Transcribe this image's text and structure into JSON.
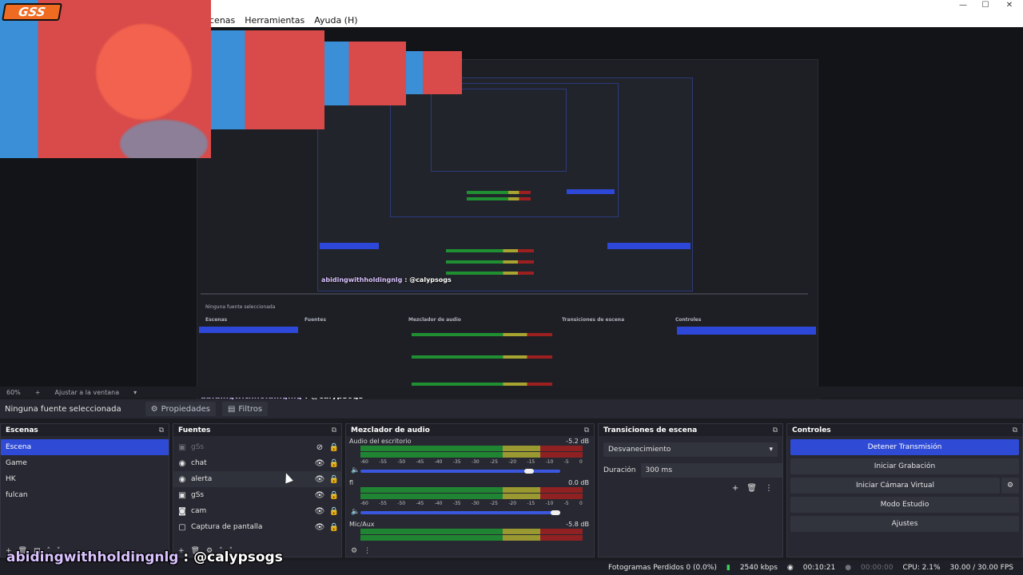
{
  "menubar": {
    "items": [
      "cenas",
      "Herramientas",
      "Ayuda (H)"
    ]
  },
  "window": {
    "minimize": "—",
    "maximize": "☐",
    "close": "✕"
  },
  "logo": "GSS",
  "zoom": {
    "level": "60%",
    "fit": "Ajustar a la ventana"
  },
  "selection": {
    "label": "Ninguna fuente seleccionada",
    "properties": "Propiedades",
    "filters": "Filtros"
  },
  "scenes": {
    "title": "Escenas",
    "items": [
      "Escena",
      "Game",
      "HK",
      "fulcan"
    ],
    "selected_index": 0
  },
  "sources": {
    "title": "Fuentes",
    "items": [
      {
        "label": "gSs",
        "icon": "image",
        "visible": false
      },
      {
        "label": "chat",
        "icon": "browser",
        "visible": true
      },
      {
        "label": "alerta",
        "icon": "browser",
        "visible": true
      },
      {
        "label": "gSs",
        "icon": "image",
        "visible": true
      },
      {
        "label": "cam",
        "icon": "camera",
        "visible": true
      },
      {
        "label": "Captura de pantalla",
        "icon": "display",
        "visible": true
      }
    ]
  },
  "mixer": {
    "title": "Mezclador de audio",
    "ticks": [
      "-60",
      "-55",
      "-50",
      "-45",
      "-40",
      "-35",
      "-30",
      "-25",
      "-20",
      "-15",
      "-10",
      "-5",
      "0"
    ],
    "channels": [
      {
        "name": "Audio del escritorio",
        "db": "-5.2 dB",
        "level": 0.86
      },
      {
        "name": "fl",
        "db": "0.0 dB",
        "level": 1.0
      },
      {
        "name": "Mic/Aux",
        "db": "-5.8 dB",
        "level": 0.85
      }
    ]
  },
  "transitions": {
    "title": "Transiciones de escena",
    "type": "Desvanecimiento",
    "duration_label": "Duración",
    "duration_value": "300 ms"
  },
  "controls": {
    "title": "Controles",
    "buttons": [
      "Detener Transmisión",
      "Iniciar Grabación",
      "Iniciar Cámara Virtual",
      "Modo Estudio",
      "Ajustes"
    ]
  },
  "status": {
    "dropped": "Fotogramas Perdidos 0 (0.0%)",
    "bitrate": "2540 kbps",
    "live_time": "00:10:21",
    "rec_time": "00:00:00",
    "cpu": "CPU: 2.1%",
    "fps": "30.00 / 30.00 FPS"
  },
  "overlay": {
    "user": "abidingwithholdingnlg",
    "separator": " : ",
    "message": "@calypsogs"
  },
  "colors": {
    "accent": "#2f4bd5",
    "panel": "#272831",
    "background": "#1b1c21"
  }
}
